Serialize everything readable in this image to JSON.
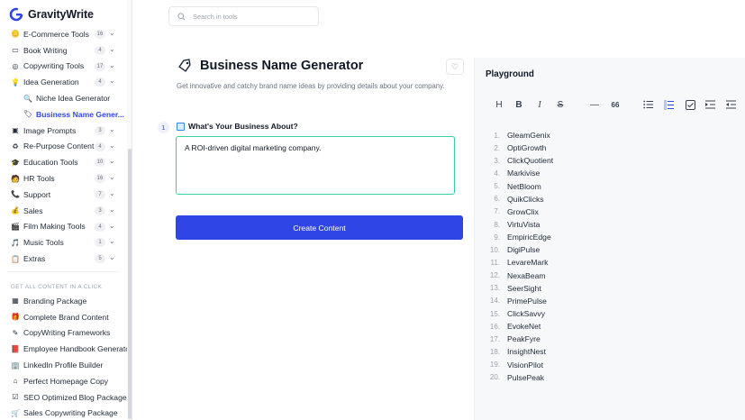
{
  "brand": {
    "name": "GravityWrite"
  },
  "search": {
    "placeholder": "Search in tools"
  },
  "sidebar": {
    "items": [
      {
        "label": "E-Commerce Tools",
        "badge": "16",
        "icon": "coin-icon"
      },
      {
        "label": "Book Writing",
        "badge": "4",
        "icon": "book-icon"
      },
      {
        "label": "Copywriting Tools",
        "badge": "17",
        "icon": "target-icon"
      },
      {
        "label": "Idea Generation",
        "badge": "4",
        "icon": "lightbulb-icon"
      },
      {
        "label": "Niche Idea Generator",
        "badge": "",
        "icon": "magnifier-icon",
        "sub": true
      },
      {
        "label": "Business Name Gener...",
        "badge": "",
        "icon": "tag-icon",
        "sub": true,
        "active": true
      },
      {
        "label": "Image Prompts",
        "badge": "3",
        "icon": "image-icon"
      },
      {
        "label": "Re-Purpose Content",
        "badge": "4",
        "icon": "recycle-icon"
      },
      {
        "label": "Education Tools",
        "badge": "10",
        "icon": "graduation-cap-icon"
      },
      {
        "label": "HR Tools",
        "badge": "16",
        "icon": "person-laptop-icon"
      },
      {
        "label": "Support",
        "badge": "7",
        "icon": "phone-icon"
      },
      {
        "label": "Sales",
        "badge": "3",
        "icon": "money-bag-icon"
      },
      {
        "label": "Film Making Tools",
        "badge": "4",
        "icon": "film-icon"
      },
      {
        "label": "Music Tools",
        "badge": "1",
        "icon": "music-icon"
      },
      {
        "label": "Extras",
        "badge": "5",
        "icon": "clipboard-icon"
      }
    ],
    "section_title": "GET ALL CONTENT IN A CLICK",
    "packages": [
      {
        "label": "Branding Package",
        "icon": "palette-icon"
      },
      {
        "label": "Complete Brand Content",
        "icon": "gift-icon"
      },
      {
        "label": "CopyWriting Frameworks",
        "icon": "pen-icon"
      },
      {
        "label": "Employee Handbook Generator",
        "icon": "handbook-icon"
      },
      {
        "label": "LinkedIn Profile Builder",
        "icon": "building-icon"
      },
      {
        "label": "Perfect Homepage Copy",
        "icon": "home-icon"
      },
      {
        "label": "SEO Optimized Blog Package",
        "icon": "check-box-icon"
      },
      {
        "label": "Sales Copywriting Package",
        "icon": "cart-icon"
      }
    ]
  },
  "main": {
    "title": "Business Name Generator",
    "subtitle": "Get innovative and catchy brand name ideas by providing details about your company.",
    "step_number": "1",
    "question": "What's Your Business About?",
    "answer": "A ROI-driven digital marketing company.",
    "create_button": "Create Content"
  },
  "playground": {
    "title": "Playground",
    "toolbar": [
      "H",
      "B",
      "I",
      "S",
      "—",
      "66",
      "bullet-list-icon",
      "numbered-list-icon",
      "checklist-icon",
      "indent-icon",
      "outdent-icon"
    ],
    "results": [
      "GleamGenix",
      "OptiGrowth",
      "ClickQuotient",
      "Markivise",
      "NetBloom",
      "QuikClicks",
      "GrowClix",
      "VirtuVista",
      "EmpiricEdge",
      "DigiPulse",
      "LevareMark",
      "NexaBeam",
      "SeerSight",
      "PrimePulse",
      "ClickSavvy",
      "EvokeNet",
      "PeakFyre",
      "InsightNest",
      "VisionPilot",
      "PulsePeak"
    ]
  },
  "colors": {
    "accent": "#2f45e6",
    "active_text": "#3347e8",
    "input_border": "#34d399",
    "playground_bg": "#f7f8fa"
  }
}
